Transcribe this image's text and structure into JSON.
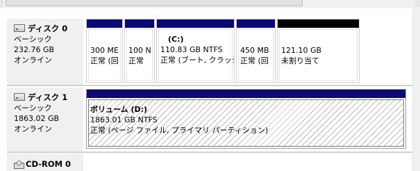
{
  "disks": [
    {
      "name": "ディスク 0",
      "type": "ベーシック",
      "size": "232.76 GB",
      "status": "オンライン",
      "partitions": [
        {
          "line1": "",
          "line2": "300 ME",
          "line3": "正常 (回"
        },
        {
          "line1": "",
          "line2": "100 N",
          "line3": "正常"
        },
        {
          "line1": "(C:)",
          "line2": "110.83 GB NTFS",
          "line3": "正常 (ブート, クラッシ"
        },
        {
          "line1": "",
          "line2": "450 MB",
          "line3": "正常 (回"
        },
        {
          "line1": "",
          "line2": "121.10 GB",
          "line3": "未割り当て"
        }
      ]
    },
    {
      "name": "ディスク 1",
      "type": "ベーシック",
      "size": "1863.02 GB",
      "status": "オンライン",
      "partitions": [
        {
          "line1": "ボリューム (D:)",
          "line2": "1863.01 GB NTFS",
          "line3": "正常 (ページ ファイル, プライマリ パーティション)"
        }
      ]
    },
    {
      "name": "CD-ROM 0"
    }
  ],
  "icons": {
    "disk": "hard-disk-icon",
    "cdrom": "cd-drive-icon"
  },
  "colors": {
    "primary_bar": "#09097a",
    "unallocated_bar": "#000000",
    "label_bg": "#f0f0f0"
  }
}
